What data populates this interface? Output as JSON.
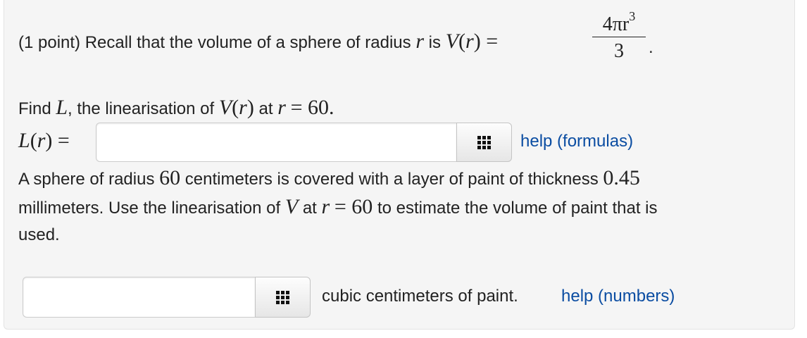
{
  "intro": {
    "prefix": "(1 point) Recall that the volume of a sphere of radius",
    "var_r": "r",
    "is": "is",
    "V": "V",
    "open_r_close": "(r) =",
    "frac_num": "4πr",
    "frac_sup": "3",
    "frac_den": "3",
    "period": "."
  },
  "find": {
    "prefix": "Find",
    "L": "L",
    "mid": ", the linearisation of",
    "V": "V",
    "Vr": "(r)",
    "at": "at",
    "r": "r",
    "eq": "= 60."
  },
  "answer1": {
    "label_L": "L",
    "label_rest": "(r) =",
    "value": "",
    "help_link": "help (formulas)"
  },
  "paragraph": {
    "line1_a": "A sphere of radius",
    "line1_n1": "60",
    "line1_b": "centimeters is covered with a layer of paint of thickness",
    "line1_n2": "0.45",
    "line2_a": "millimeters. Use the linearisation of",
    "line2_V": "V",
    "line2_at": "at",
    "line2_r": "r",
    "line2_eq": "= 60",
    "line2_b": "to estimate the volume of paint that is",
    "line3": "used."
  },
  "answer2": {
    "value": "",
    "suffix": "cubic centimeters of paint.",
    "help_link": "help (numbers)"
  }
}
